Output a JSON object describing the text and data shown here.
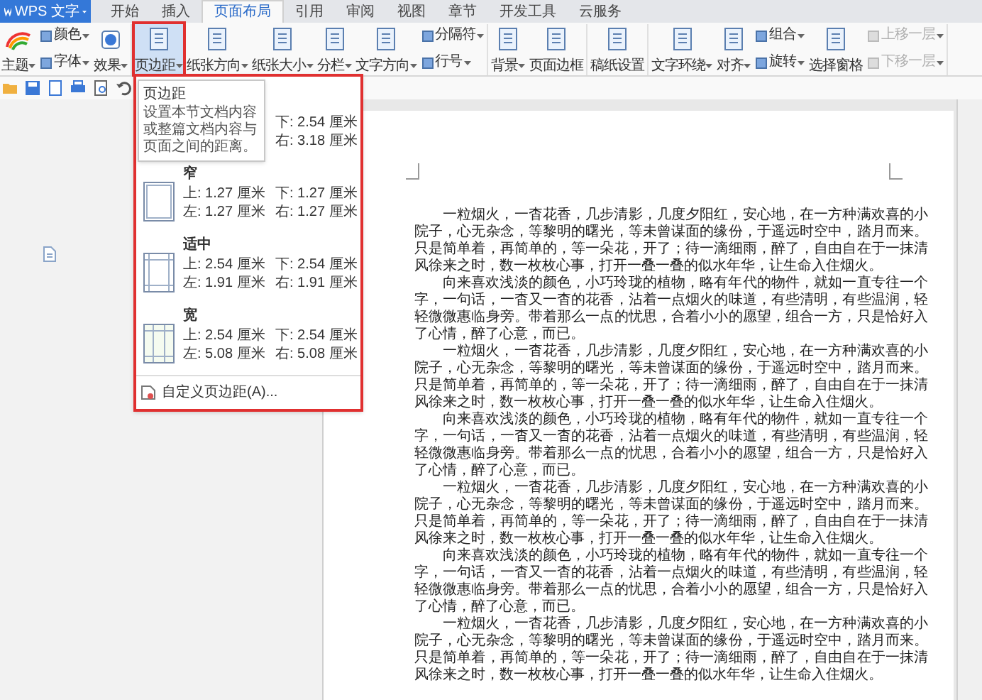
{
  "app_menu": {
    "label": "WPS 文字"
  },
  "tabs": [
    {
      "label": "开始",
      "selected": false
    },
    {
      "label": "插入",
      "selected": false
    },
    {
      "label": "页面布局",
      "selected": true
    },
    {
      "label": "引用",
      "selected": false
    },
    {
      "label": "审阅",
      "selected": false
    },
    {
      "label": "视图",
      "selected": false
    },
    {
      "label": "章节",
      "selected": false
    },
    {
      "label": "开发工具",
      "selected": false
    },
    {
      "label": "云服务",
      "selected": false
    }
  ],
  "ribbon_groups": [
    {
      "items": [
        {
          "kind": "large",
          "label": "主题",
          "dropdown": true,
          "selected": false,
          "disabled": false
        },
        {
          "kind": "stack",
          "children": [
            {
              "label": "颜色",
              "dropdown": true,
              "disabled": false
            },
            {
              "label": "字体",
              "dropdown": true,
              "disabled": false
            }
          ]
        },
        {
          "kind": "large",
          "label": "效果",
          "dropdown": true,
          "selected": false,
          "disabled": false
        }
      ]
    },
    {
      "items": [
        {
          "kind": "large",
          "label": "页边距",
          "dropdown": true,
          "selected": true,
          "disabled": false
        },
        {
          "kind": "large",
          "label": "纸张方向",
          "dropdown": true,
          "selected": false,
          "disabled": false
        },
        {
          "kind": "large",
          "label": "纸张大小",
          "dropdown": true,
          "selected": false,
          "disabled": false
        },
        {
          "kind": "large",
          "label": "分栏",
          "dropdown": true,
          "selected": false,
          "disabled": false
        },
        {
          "kind": "large",
          "label": "文字方向",
          "dropdown": true,
          "selected": false,
          "disabled": false
        },
        {
          "kind": "stack",
          "children": [
            {
              "label": "分隔符",
              "dropdown": true,
              "disabled": false
            },
            {
              "label": "行号",
              "dropdown": true,
              "disabled": false
            }
          ]
        }
      ]
    },
    {
      "items": [
        {
          "kind": "large",
          "label": "背景",
          "dropdown": true,
          "selected": false,
          "disabled": false
        },
        {
          "kind": "large",
          "label": "页面边框",
          "dropdown": false,
          "selected": false,
          "disabled": false
        }
      ]
    },
    {
      "items": [
        {
          "kind": "large",
          "label": "稿纸设置",
          "dropdown": false,
          "selected": false,
          "disabled": false
        }
      ]
    },
    {
      "items": [
        {
          "kind": "large",
          "label": "文字环绕",
          "dropdown": true,
          "selected": false,
          "disabled": false
        },
        {
          "kind": "large",
          "label": "对齐",
          "dropdown": true,
          "selected": false,
          "disabled": false
        },
        {
          "kind": "stack",
          "children": [
            {
              "label": "组合",
              "dropdown": true,
              "disabled": false
            },
            {
              "label": "旋转",
              "dropdown": true,
              "disabled": false
            }
          ]
        },
        {
          "kind": "large",
          "label": "选择窗格",
          "dropdown": false,
          "selected": false,
          "disabled": false
        },
        {
          "kind": "stack",
          "children": [
            {
              "label": "上移一层",
              "dropdown": true,
              "disabled": true
            },
            {
              "label": "下移一层",
              "dropdown": true,
              "disabled": true
            }
          ]
        }
      ]
    }
  ],
  "margin_menu": {
    "highlighted": true,
    "tooltip": {
      "title": "页边距",
      "text": "设置本节文档内容或整篇文档内容与页面之间的距离。"
    },
    "presets": [
      {
        "bottom": "下: 2.54 厘米",
        "right": "右: 3.18 厘米"
      },
      {
        "kind": "narrow",
        "name": "窄",
        "top": "上: 1.27 厘米",
        "bottom": "下: 1.27 厘米",
        "left": "左: 1.27 厘米",
        "right": "右: 1.27 厘米"
      },
      {
        "kind": "moderate",
        "name": "适中",
        "top": "上: 2.54 厘米",
        "bottom": "下: 2.54 厘米",
        "left": "左: 1.91 厘米",
        "right": "右: 1.91 厘米"
      },
      {
        "kind": "wide",
        "name": "宽",
        "top": "上: 2.54 厘米",
        "bottom": "下: 2.54 厘米",
        "left": "左: 5.08 厘米",
        "right": "右: 5.08 厘米"
      }
    ],
    "custom": "自定义页边距(A)..."
  },
  "document": {
    "paragraphs": [
      "一粒烟火，一杳花香，几步清影，几度夕阳红，安心地，在一方种满欢喜的小院子，心无杂念，等黎明的曙光，等未曾谋面的缘份，于遥远时空中，踏月而来。只是简单着，再简单的，等一朵花，开了；待一滴细雨，醉了，自由自在于一抹清风徐来之时，数一枚枚心事，打开一叠一叠的似水年华，让生命入住烟火。",
      "向来喜欢浅淡的颜色，小巧玲珑的植物，略有年代的物件，就如一直专往一个字，一句话，一杳又一杳的花香，沾着一点烟火的味道，有些清明，有些温润，轻轻微微惠临身旁。带着那么一点的忧思，合着小小的愿望，组合一方，只是恰好入了心情，醉了心意，而已。",
      "一粒烟火，一杳花香，几步清影，几度夕阳红，安心地，在一方种满欢喜的小院子，心无杂念，等黎明的曙光，等未曾谋面的缘份，于遥远时空中，踏月而来。只是简单着，再简单的，等一朵花，开了；待一滴细雨，醉了，自由自在于一抹清风徐来之时，数一枚枚心事，打开一叠一叠的似水年华，让生命入住烟火。",
      "向来喜欢浅淡的颜色，小巧玲珑的植物，略有年代的物件，就如一直专往一个字，一句话，一杳又一杳的花香，沾着一点烟火的味道，有些清明，有些温润，轻轻微微惠临身旁。带着那么一点的忧思，合着小小的愿望，组合一方，只是恰好入了心情，醉了心意，而已。",
      "一粒烟火，一杳花香，几步清影，几度夕阳红，安心地，在一方种满欢喜的小院子，心无杂念，等黎明的曙光，等未曾谋面的缘份，于遥远时空中，踏月而来。只是简单着，再简单的，等一朵花，开了；待一滴细雨，醉了，自由自在于一抹清风徐来之时，数一枚枚心事，打开一叠一叠的似水年华，让生命入住烟火。",
      "向来喜欢浅淡的颜色，小巧玲珑的植物，略有年代的物件，就如一直专往一个字，一句话，一杳又一杳的花香，沾着一点烟火的味道，有些清明，有些温润，轻轻微微惠临身旁。带着那么一点的忧思，合着小小的愿望，组合一方，只是恰好入了心情，醉了心意，而已。",
      "一粒烟火，一杳花香，几步清影，几度夕阳红，安心地，在一方种满欢喜的小院子，心无杂念，等黎明的曙光，等未曾谋面的缘份，于遥远时空中，踏月而来。只是简单着，再简单的，等一朵花，开了；待一滴细雨，醉了，自由自在于一抹清风徐来之时，数一枚枚心事，打开一叠一叠的似水年华，让生命入住烟火。"
    ]
  }
}
